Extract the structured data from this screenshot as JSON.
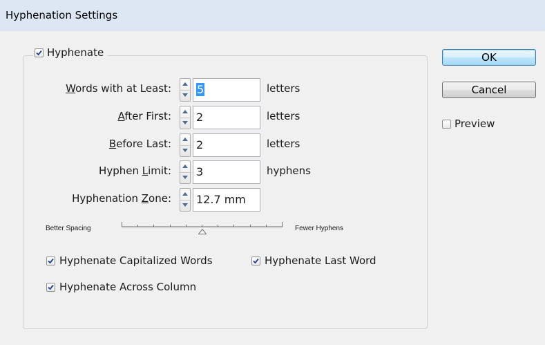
{
  "window": {
    "title": "Hyphenation Settings"
  },
  "hyphenate": {
    "label": "Hyphenate",
    "checked": true
  },
  "fields": {
    "words_at_least": {
      "label_pre": "",
      "label_ul": "W",
      "label_post": "ords with at Least:",
      "value": "5",
      "unit": "letters"
    },
    "after_first": {
      "label_pre": "",
      "label_ul": "A",
      "label_post": "fter First:",
      "value": "2",
      "unit": "letters"
    },
    "before_last": {
      "label_pre": "",
      "label_ul": "B",
      "label_post": "efore Last:",
      "value": "2",
      "unit": "letters"
    },
    "hyphen_limit": {
      "label_pre": "Hyphen ",
      "label_ul": "L",
      "label_post": "imit:",
      "value": "3",
      "unit": "hyphens"
    },
    "hyphenation_zone": {
      "label_pre": "Hyphenation ",
      "label_ul": "Z",
      "label_post": "one:",
      "value": "12.7 mm"
    }
  },
  "slider": {
    "left_label": "Better Spacing",
    "right_label": "Fewer Hyphens",
    "ticks": 10,
    "position": 0.5
  },
  "options": {
    "capitalized": {
      "label": "Hyphenate Capitalized Words",
      "checked": true
    },
    "last_word": {
      "label": "Hyphenate Last Word",
      "checked": true
    },
    "across_column": {
      "label": "Hyphenate Across Column",
      "checked": true
    }
  },
  "buttons": {
    "ok": "OK",
    "cancel": "Cancel"
  },
  "preview": {
    "label": "Preview",
    "checked": false
  },
  "colors": {
    "titlebar": "#dde7f3",
    "selection": "#3399ff",
    "checkmark": "#1c3f94"
  }
}
